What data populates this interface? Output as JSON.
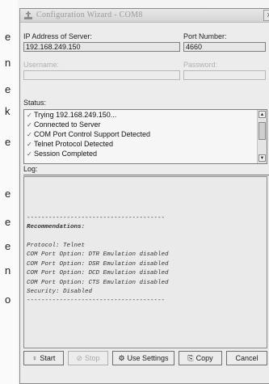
{
  "left_fragment": [
    "e",
    "n",
    "e",
    "k",
    "e",
    "e",
    "e",
    "e",
    "n",
    "o"
  ],
  "window": {
    "title": "Configuration Wizard - COM8",
    "close_label": "x"
  },
  "ip": {
    "label": "IP Address of Server:",
    "value": "192.168.249.150"
  },
  "port": {
    "label": "Port Number:",
    "value": "4660"
  },
  "username": {
    "label": "Username:",
    "value": ""
  },
  "password": {
    "label": "Password:",
    "value": ""
  },
  "status": {
    "label": "Status:",
    "items": [
      "Trying 192.168.249.150...",
      "Connected to Server",
      "COM Port Control Support Detected",
      "Telnet Protocol Detected",
      "Session Completed"
    ]
  },
  "log": {
    "label": "Log:",
    "lines": [
      "--------------------------------------",
      "Recommendations:",
      "",
      "Protocol: Telnet",
      "COM Port Option: DTR Emulation disabled",
      "COM Port Option: DSR Emulation disabled",
      "COM Port Option: DCD Emulation disabled",
      "COM Port Option: CTS Emulation disabled",
      "Security: Disabled",
      "--------------------------------------"
    ]
  },
  "buttons": {
    "start": "Start",
    "stop": "Stop",
    "use_settings": "Use Settings",
    "copy": "Copy",
    "cancel": "Cancel"
  }
}
